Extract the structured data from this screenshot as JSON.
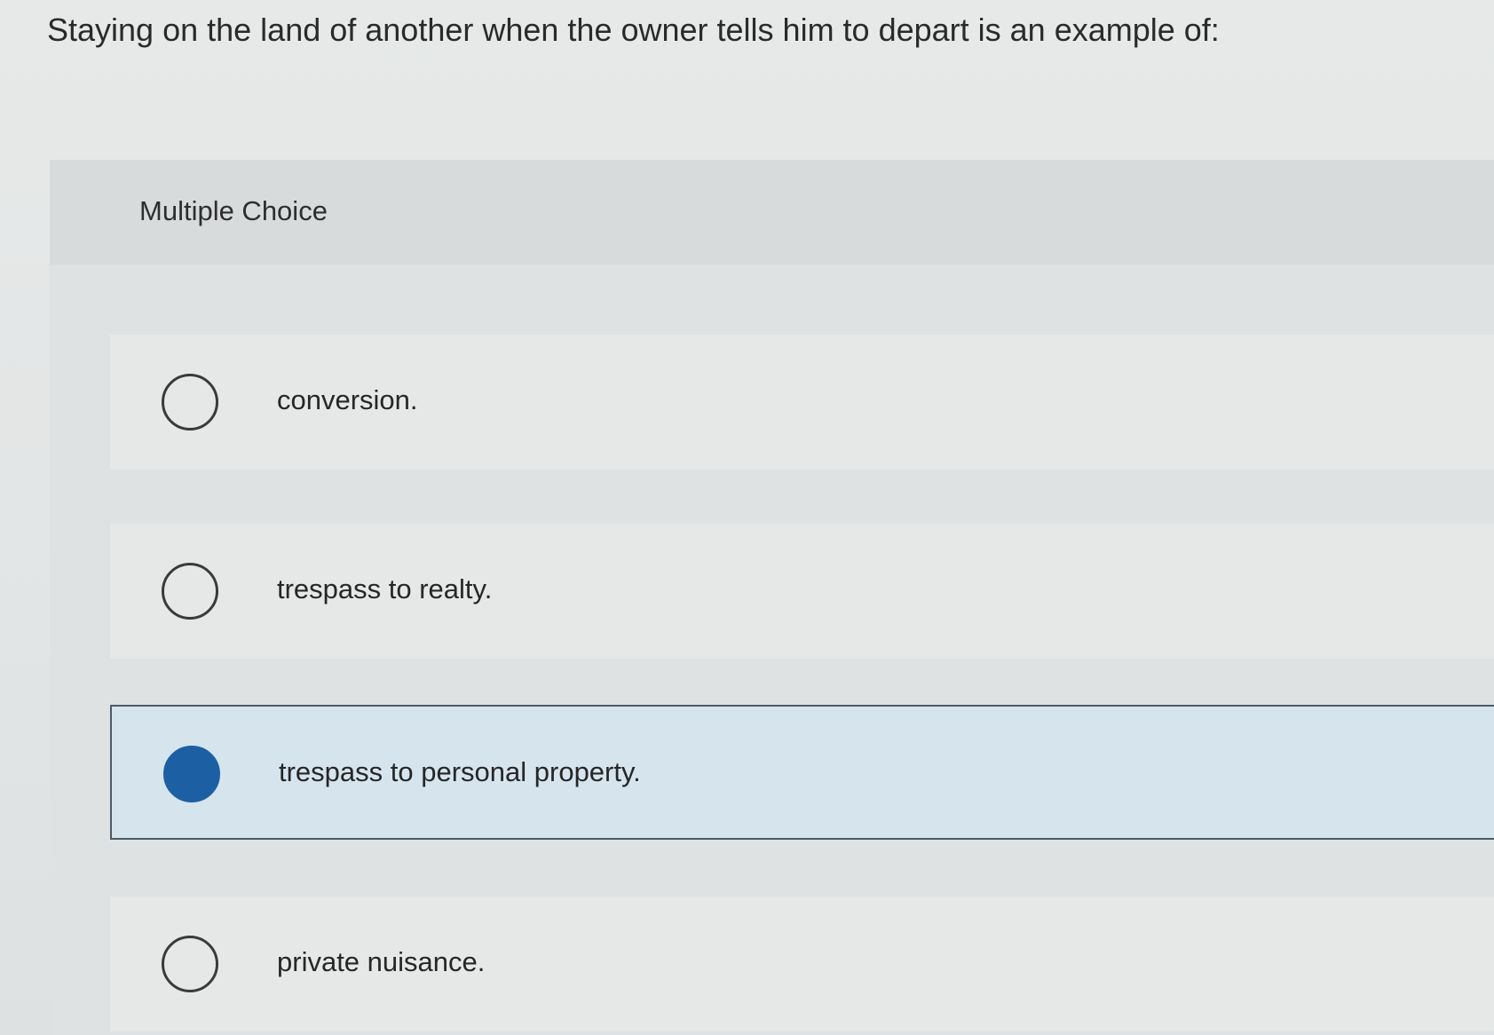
{
  "question": {
    "text": "Staying on the land of another when the owner tells him to depart is an example of:"
  },
  "panel": {
    "header_label": "Multiple Choice"
  },
  "options": [
    {
      "label": "conversion.",
      "selected": false
    },
    {
      "label": "trespass to realty.",
      "selected": false
    },
    {
      "label": "trespass to personal property.",
      "selected": true
    },
    {
      "label": "private nuisance.",
      "selected": false
    }
  ],
  "colors": {
    "selected_fill": "#1d5fa3",
    "selected_background": "#d6e4ee"
  }
}
